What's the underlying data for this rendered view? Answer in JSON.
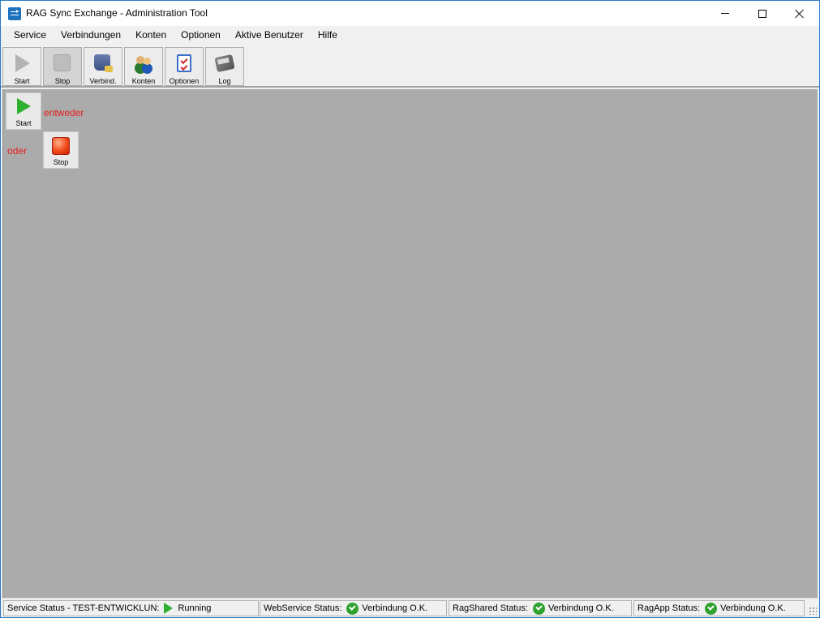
{
  "window": {
    "title": "RAG Sync Exchange - Administration Tool",
    "icon": "app-sync-icon"
  },
  "menu": [
    "Service",
    "Verbindungen",
    "Konten",
    "Optionen",
    "Aktive Benutzer",
    "Hilfe"
  ],
  "toolbar": [
    {
      "label": "Start",
      "icon": "play-icon",
      "state": "disabled"
    },
    {
      "label": "Stop",
      "icon": "stop-icon",
      "state": "pressed"
    },
    {
      "label": "Verbind.",
      "icon": "database-icon"
    },
    {
      "label": "Konten",
      "icon": "users-icon"
    },
    {
      "label": "Optionen",
      "icon": "checklist-icon"
    },
    {
      "label": "Log",
      "icon": "log-book-icon"
    }
  ],
  "workspace": {
    "start_label": "Start",
    "stop_label": "Stop",
    "either_text": "entweder",
    "or_text": "oder",
    "background": "#ababab",
    "annotation_color": "#e81c1c"
  },
  "statusbar": {
    "service_label": "Service Status - TEST-ENTWICKLUN:",
    "service_value": "Running",
    "webservice_label": "WebService Status:",
    "webservice_value": "Verbindung O.K.",
    "ragshared_label": "RagShared Status:",
    "ragshared_value": "Verbindung O.K.",
    "ragapp_label": "RagApp Status:",
    "ragapp_value": "Verbindung O.K."
  }
}
